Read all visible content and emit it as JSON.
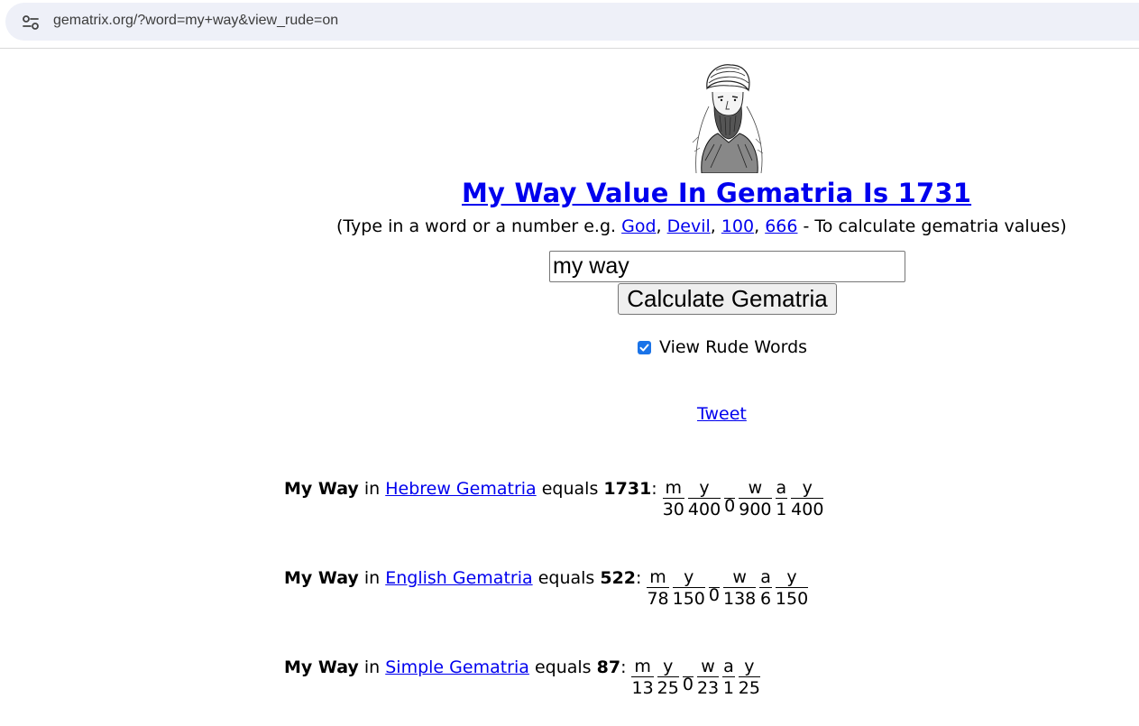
{
  "browser": {
    "url": "gematrix.org/?word=my+way&view_rude=on"
  },
  "header": {
    "title": "My Way Value In Gematria Is 1731",
    "hint_prefix": "(Type in a word or a number e.g. ",
    "hint_links": [
      "God",
      "Devil",
      "100",
      "666"
    ],
    "hint_suffix": " - To calculate gematria values)",
    "sep": ", "
  },
  "form": {
    "input_value": "my way",
    "button_label": "Calculate Gematria",
    "rude_label": "View Rude Words",
    "rude_checked": true
  },
  "tweet_label": "Tweet",
  "results": [
    {
      "phrase": "My Way",
      "in": "in",
      "system": "Hebrew Gematria",
      "equals": "equals",
      "total": "1731",
      "letters": [
        {
          "ch": "m",
          "val": "30"
        },
        {
          "ch": "y",
          "val": "400"
        },
        {
          "ch": " ",
          "val": "0"
        },
        {
          "ch": "w",
          "val": "900"
        },
        {
          "ch": "a",
          "val": "1"
        },
        {
          "ch": "y",
          "val": "400"
        }
      ]
    },
    {
      "phrase": "My Way",
      "in": "in",
      "system": "English Gematria",
      "equals": "equals",
      "total": "522",
      "letters": [
        {
          "ch": "m",
          "val": "78"
        },
        {
          "ch": "y",
          "val": "150"
        },
        {
          "ch": " ",
          "val": "0"
        },
        {
          "ch": "w",
          "val": "138"
        },
        {
          "ch": "a",
          "val": "6"
        },
        {
          "ch": "y",
          "val": "150"
        }
      ]
    },
    {
      "phrase": "My Way",
      "in": "in",
      "system": "Simple Gematria",
      "equals": "equals",
      "total": "87",
      "letters": [
        {
          "ch": "m",
          "val": "13"
        },
        {
          "ch": "y",
          "val": "25"
        },
        {
          "ch": " ",
          "val": "0"
        },
        {
          "ch": "w",
          "val": "23"
        },
        {
          "ch": "a",
          "val": "1"
        },
        {
          "ch": "y",
          "val": "25"
        }
      ]
    }
  ],
  "colors": {
    "link": "#0000ee",
    "checkbox": "#1a73e8"
  }
}
